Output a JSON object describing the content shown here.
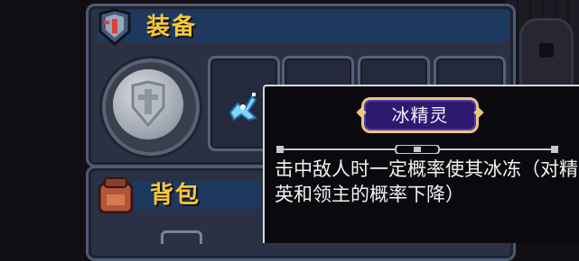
{
  "equipment_panel": {
    "title": "装备",
    "icon": "helmet-icon",
    "slot_icon": "shield-icon",
    "equipped_item_icon": "ice-spirit-icon"
  },
  "backpack_panel": {
    "title": "背包",
    "icon": "backpack-icon"
  },
  "tooltip": {
    "item_name": "冰精灵",
    "description": "击中敌人时一定概率使其冰冻（对精英和领主的概率下降）"
  },
  "colors": {
    "title_gold": "#f4c83c",
    "panel_bg": "#2a3145",
    "name_badge_bg": "#2b1a6e",
    "name_badge_border": "#e8c877",
    "tooltip_bg": "#0a0a0e"
  }
}
